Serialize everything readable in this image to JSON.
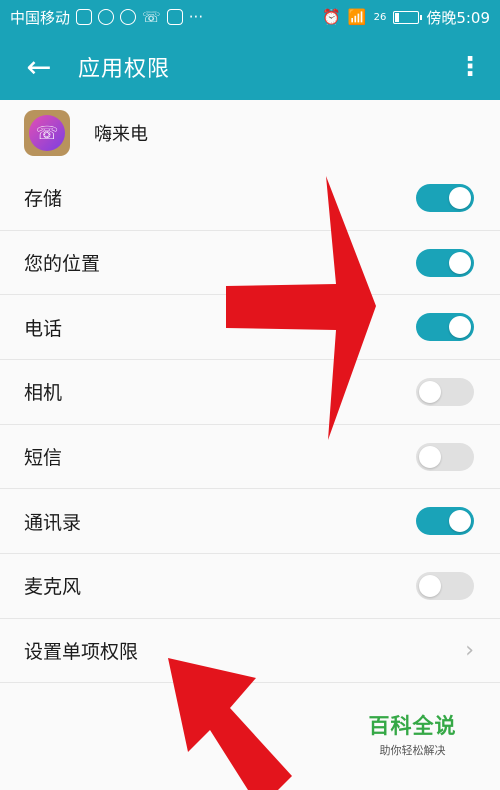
{
  "status_bar": {
    "carrier": "中国移动",
    "dots": "···",
    "network": "26",
    "time": "傍晚5:09",
    "battery_level": 0.2
  },
  "app_bar": {
    "back_icon": "←",
    "title": "应用权限",
    "more_icon": "⋮"
  },
  "app": {
    "name": "嗨来电",
    "icon_glyph": "☏"
  },
  "permissions": [
    {
      "label": "存储",
      "enabled": true
    },
    {
      "label": "您的位置",
      "enabled": true
    },
    {
      "label": "电话",
      "enabled": true
    },
    {
      "label": "相机",
      "enabled": false
    },
    {
      "label": "短信",
      "enabled": false
    },
    {
      "label": "通讯录",
      "enabled": true
    },
    {
      "label": "麦克风",
      "enabled": false
    }
  ],
  "single_permission": {
    "label": "设置单项权限",
    "chevron": "›"
  },
  "watermark": {
    "title": "百科全说",
    "subtitle": "助你轻松解决"
  },
  "colors": {
    "accent": "#1aa3b8",
    "arrow": "#e3141c"
  }
}
